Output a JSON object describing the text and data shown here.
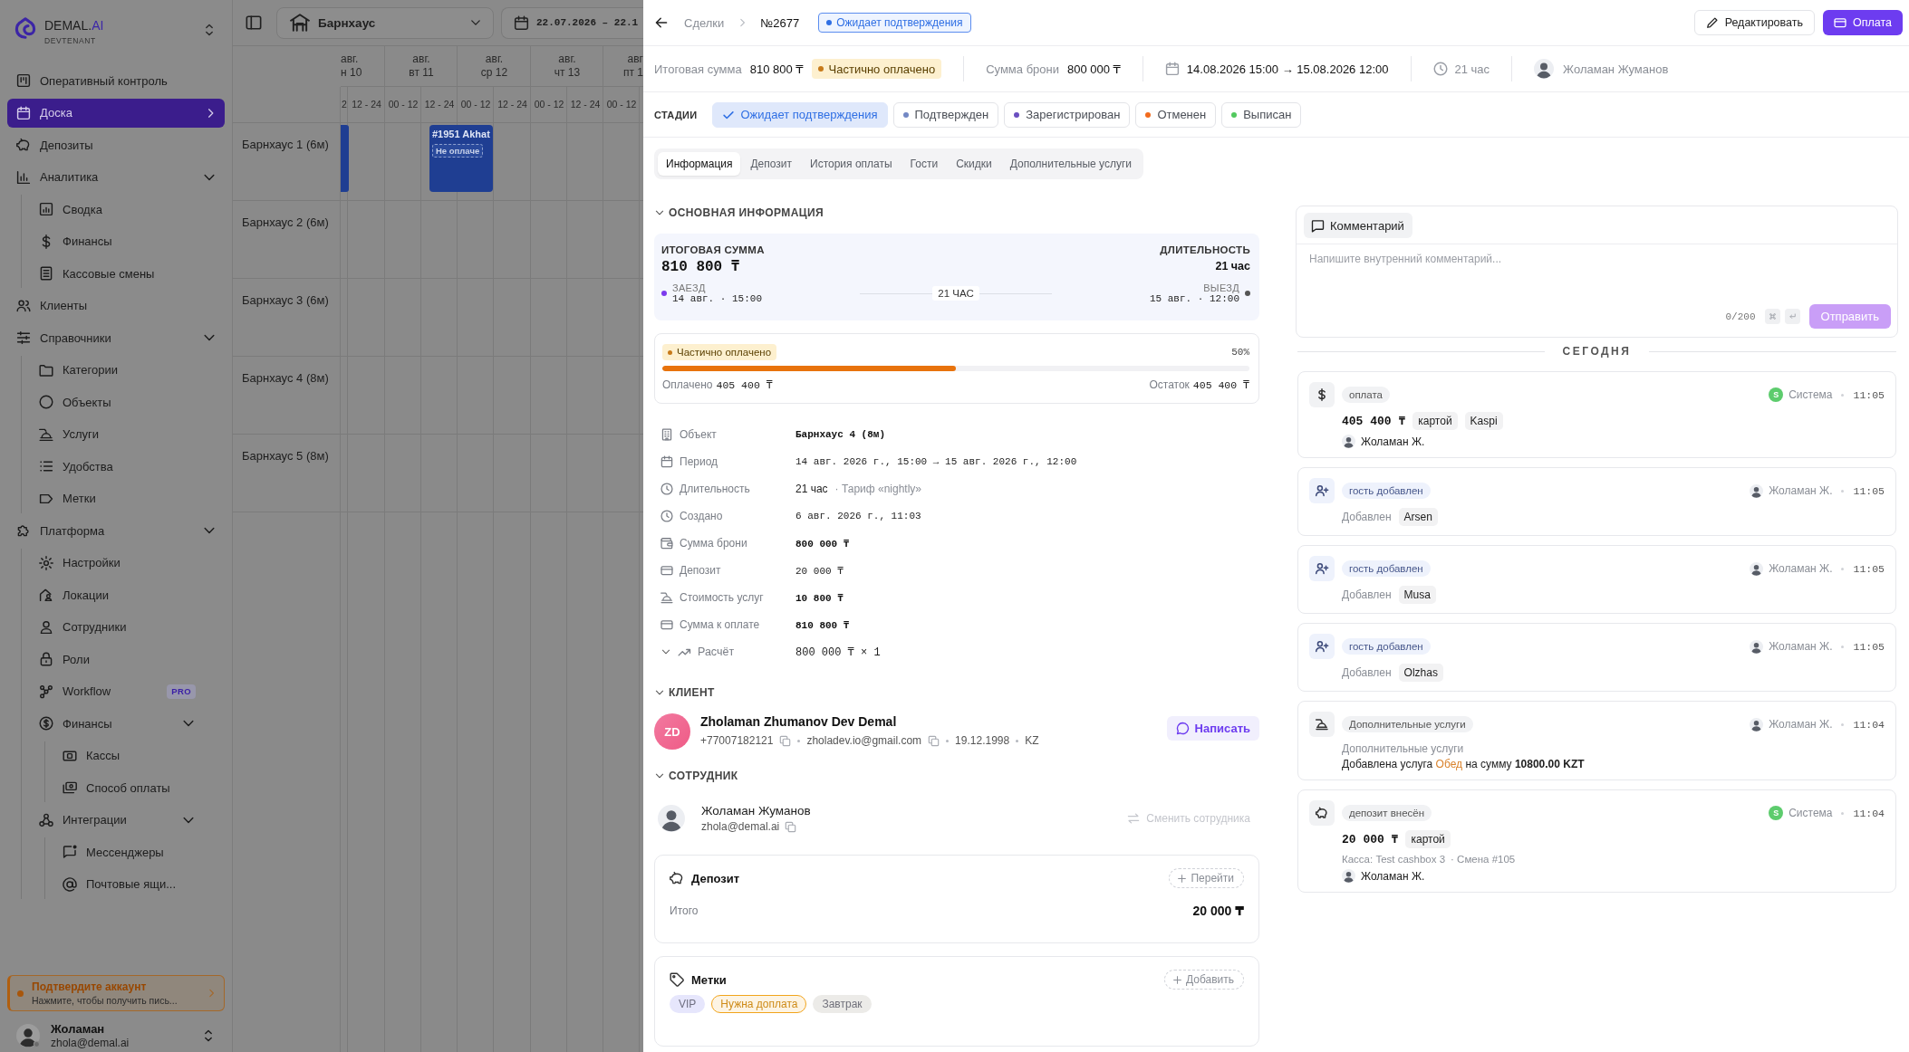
{
  "sidebar": {
    "brand": {
      "name": "DEMAL.",
      "accent": "AI",
      "tenant": "DEVTENANT"
    },
    "items": [
      {
        "label": "Оперативный контроль",
        "selected": false
      },
      {
        "label": "Доска",
        "selected": true
      },
      {
        "label": "Депозиты",
        "selected": false
      },
      {
        "label": "Аналитика",
        "selected": false,
        "expanded": true,
        "children": [
          {
            "label": "Сводка",
            "selected": false
          },
          {
            "label": "Финансы",
            "selected": false
          },
          {
            "label": "Кассовые смены",
            "selected": false
          }
        ]
      },
      {
        "label": "Клиенты",
        "selected": false
      },
      {
        "label": "Справочники",
        "selected": false,
        "expanded": true,
        "children": [
          {
            "label": "Категории",
            "selected": false
          },
          {
            "label": "Объекты",
            "selected": false
          },
          {
            "label": "Услуги",
            "selected": false
          },
          {
            "label": "Удобства",
            "selected": false
          },
          {
            "label": "Метки",
            "selected": false
          }
        ]
      },
      {
        "label": "Платформа",
        "selected": false,
        "expanded": true,
        "children": [
          {
            "label": "Настройки",
            "selected": false
          },
          {
            "label": "Локации",
            "selected": false
          },
          {
            "label": "Сотрудники",
            "selected": false
          },
          {
            "label": "Роли",
            "selected": false
          },
          {
            "label": "Workflow",
            "selected": false,
            "badge": "PRO"
          },
          {
            "label": "Финансы",
            "selected": false,
            "expanded": true,
            "children": [
              {
                "label": "Кассы",
                "selected": false
              },
              {
                "label": "Способ оплаты",
                "selected": false
              }
            ]
          },
          {
            "label": "Интеграции",
            "selected": false,
            "expanded": true,
            "children": [
              {
                "label": "Мессенджеры",
                "selected": false
              },
              {
                "label": "Почтовые ящи...",
                "selected": false
              }
            ]
          }
        ]
      }
    ],
    "notice": {
      "title": "Подтвердите аккаунт",
      "text": "Нажмите, чтобы получить пись..."
    },
    "user": {
      "name": "Жоламан",
      "email": "zhola@demal.ai"
    }
  },
  "board": {
    "property": "Барнхаус",
    "date_range": "22.07.2026 – 22.1",
    "days": [
      {
        "month": "авг.",
        "day": "н 10"
      },
      {
        "month": "авг.",
        "day": "вт 11"
      },
      {
        "month": "авг.",
        "day": "ср 12"
      },
      {
        "month": "авг.",
        "day": "чт 13"
      },
      {
        "month": "авг",
        "day": "пт 1"
      }
    ],
    "slots": [
      "2",
      "12 - 24",
      "00 - 12",
      "12 - 24",
      "00 - 12",
      "12 - 24",
      "00 - 12",
      "12 - 24",
      "00 - 12"
    ],
    "rows": [
      {
        "label": "Барнхаус 1 (6м)",
        "bookings": [
          {
            "kind": "edge"
          },
          {
            "kind": "block",
            "title": "#1951 Akhat",
            "status": "Не оплаче"
          }
        ]
      },
      {
        "label": "Барнхаус 2 (6м)"
      },
      {
        "label": "Барнхаус 3 (6м)"
      },
      {
        "label": "Барнхаус 4 (8м)"
      },
      {
        "label": "Барнхаус 5 (8м)"
      }
    ]
  },
  "deal": {
    "breadcrumb": {
      "parent": "Сделки",
      "current": "№2677"
    },
    "status": "Ожидает подтверждения",
    "actions": [
      {
        "label": "Редактировать",
        "kind": "secondary"
      },
      {
        "label": "Оплата",
        "kind": "primary"
      }
    ],
    "summary": {
      "total_label": "Итоговая сумма",
      "total": "810 800 ₸",
      "payment_status": "Частично оплачено",
      "booking_label": "Сумма брони",
      "booking_amount": "800 000 ₸",
      "period": "14.08.2026 15:00 → 15.08.2026 12:00",
      "duration": "21 час",
      "manager": "Жоламан Жуманов"
    },
    "stages": {
      "label": "СТАДИИ",
      "items": [
        {
          "label": "Ожидает подтверждения",
          "selected": true,
          "color": "#2f6fe4"
        },
        {
          "label": "Подтвержден",
          "selected": false,
          "color": "#7388c4"
        },
        {
          "label": "Зарегистрирован",
          "selected": false,
          "color": "#6a4fc0"
        },
        {
          "label": "Отменен",
          "selected": false,
          "color": "#f26b1d"
        },
        {
          "label": "Выписан",
          "selected": false,
          "color": "#52c95e"
        }
      ]
    },
    "tabs": [
      {
        "label": "Информация",
        "selected": true
      },
      {
        "label": "Депозит",
        "selected": false
      },
      {
        "label": "История оплаты",
        "selected": false
      },
      {
        "label": "Гости",
        "selected": false
      },
      {
        "label": "Скидки",
        "selected": false
      },
      {
        "label": "Дополнительные услуги",
        "selected": false
      }
    ],
    "main_info": {
      "title": "ОСНОВНАЯ ИНФОРМАЦИЯ",
      "expanded": true,
      "total_label": "ИТОГОВАЯ СУММА",
      "total": "810 800 ₸",
      "duration_label": "ДЛИТЕЛЬНОСТЬ",
      "duration": "21 час",
      "check_in_label": "ЗАЕЗД",
      "check_in": "14 авг. · 15:00",
      "span": "21 ЧАС",
      "check_out_label": "ВЫЕЗД",
      "check_out": "15 авг. · 12:00"
    },
    "payment": {
      "status": "Частично оплачено",
      "percent": "50%",
      "level": 0.5,
      "paid_label": "Оплачено",
      "paid": "405 400 ₸",
      "rest_label": "Остаток",
      "rest": "405 400 ₸"
    },
    "details": [
      {
        "label": "Объект",
        "value": "Барнхаус 4 (8м)",
        "kind": "strong"
      },
      {
        "label": "Период",
        "value": "14 авг. 2026 г., 15:00 → 15 авг. 2026 г., 12:00",
        "kind": "mono"
      },
      {
        "label": "Длительность",
        "value": "21 час",
        "note": "· Тариф «nightly»",
        "kind": "text"
      },
      {
        "label": "Создано",
        "value": "6 авг. 2026 г., 11:03",
        "kind": "mono"
      },
      {
        "label": "Сумма брони",
        "value": "800 000 ₸",
        "kind": "strong"
      },
      {
        "label": "Депозит",
        "value": "20 000 ₸",
        "kind": "mono"
      },
      {
        "label": "Стоимость услуг",
        "value": "10 800 ₸",
        "kind": "strong"
      },
      {
        "label": "Сумма к оплате",
        "value": "810 800 ₸",
        "kind": "strong"
      },
      {
        "label": "Расчёт",
        "value": "800 000 ₸ × 1",
        "kind": "calc"
      }
    ],
    "client": {
      "title": "КЛИЕНТ",
      "expanded": true,
      "initials": "ZD",
      "name": "Zholaman Zhumanov Dev Demal",
      "phone": "+77007182121",
      "email": "zholadev.io@gmail.com",
      "birthday": "19.12.1998",
      "country": "KZ",
      "action": "Написать"
    },
    "employee": {
      "title": "СОТРУДНИК",
      "expanded": true,
      "name": "Жоламан Жуманов",
      "email": "zhola@demal.ai",
      "action": {
        "label": "Сменить сотрудника",
        "disabled": true
      }
    },
    "deposit": {
      "title": "Депозит",
      "action": "Перейти",
      "total_label": "Итого",
      "total": "20 000 ₸"
    },
    "tags": {
      "title": "Метки",
      "action": "Добавить",
      "items": [
        {
          "label": "VIP",
          "selected": false,
          "color": "#e6e6fc"
        },
        {
          "label": "Нужна доплата",
          "selected": true,
          "color": "#f2a41c"
        },
        {
          "label": "Завтрак",
          "selected": false,
          "color": "#ecebe8"
        }
      ]
    },
    "comment": {
      "title": "Комментарий",
      "placeholder": "Напишите внутренний комментарий...",
      "counter": "0/200",
      "submit": {
        "label": "Отправить",
        "disabled": true
      }
    },
    "feed": {
      "day": "СЕГОДНЯ",
      "events": [
        {
          "kind": "payment",
          "tag": "оплата",
          "actor": {
            "kind": "system",
            "initial": "S",
            "name": "Система"
          },
          "time": "11:05",
          "amount": "405 400 ₸",
          "chips": [
            "картой",
            "Kaspi"
          ],
          "by": "Жоламан Ж."
        },
        {
          "kind": "guest",
          "tag": "гость добавлен",
          "actor": {
            "kind": "user",
            "name": "Жоламан Ж."
          },
          "time": "11:05",
          "label": "Добавлен",
          "chips": [
            "Arsen"
          ]
        },
        {
          "kind": "guest",
          "tag": "гость добавлен",
          "actor": {
            "kind": "user",
            "name": "Жоламан Ж."
          },
          "time": "11:05",
          "label": "Добавлен",
          "chips": [
            "Musa"
          ]
        },
        {
          "kind": "guest",
          "tag": "гость добавлен",
          "actor": {
            "kind": "user",
            "name": "Жоламан Ж."
          },
          "time": "11:05",
          "label": "Добавлен",
          "chips": [
            "Olzhas"
          ]
        },
        {
          "kind": "service",
          "tag": "Дополнительные услуги",
          "actor": {
            "kind": "user",
            "name": "Жоламан Ж."
          },
          "time": "11:04",
          "caption": "Дополнительные услуги",
          "description": [
            {
              "kind": "plain",
              "text": "Добавлена услуга "
            },
            {
              "kind": "accent",
              "text": "Обед"
            },
            {
              "kind": "plain",
              "text": " на сумму "
            },
            {
              "kind": "strong",
              "text": "10800.00 KZT"
            }
          ]
        },
        {
          "kind": "deposit",
          "tag": "депозит внесён",
          "actor": {
            "kind": "system",
            "initial": "S",
            "name": "Система"
          },
          "time": "11:04",
          "amount": "20 000 ₸",
          "chips": [
            "картой"
          ],
          "notes": [
            "Касса: Test cashbox 3",
            "· Смена #105"
          ],
          "by": "Жоламан Ж."
        }
      ]
    }
  }
}
